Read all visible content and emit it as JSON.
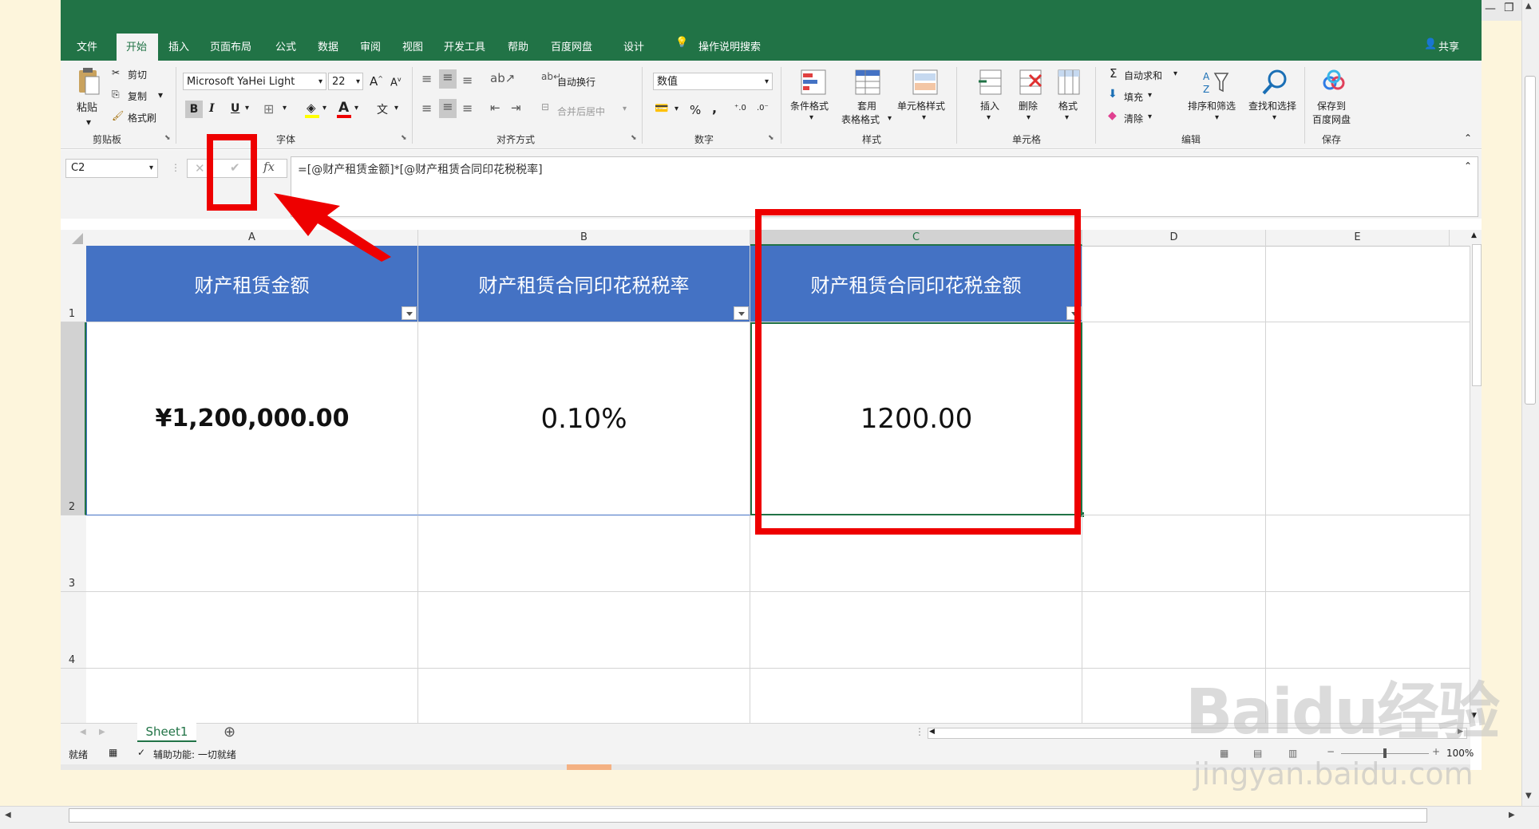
{
  "ribbon_tabs": [
    "文件",
    "开始",
    "插入",
    "页面布局",
    "公式",
    "数据",
    "审阅",
    "视图",
    "开发工具",
    "帮助",
    "百度网盘",
    "设计"
  ],
  "active_tab": "开始",
  "tell_me": "操作说明搜索",
  "share": "共享",
  "clipboard": {
    "paste": "粘贴",
    "cut": "剪切",
    "copy": "复制",
    "format_painter": "格式刷",
    "label": "剪贴板"
  },
  "font": {
    "name": "Microsoft YaHei Light",
    "size": "22",
    "bold": "B",
    "italic": "I",
    "underline": "U",
    "font_color_glyph": "A",
    "wen": "文",
    "label": "字体"
  },
  "alignment": {
    "wrap": "自动换行",
    "merge": "合并后居中",
    "label": "对齐方式"
  },
  "number": {
    "format": "数值",
    "percent": "%",
    "comma": ",",
    "label": "数字"
  },
  "styles": {
    "conditional": "条件格式",
    "table_line1": "套用",
    "table_line2": "表格格式",
    "cell_styles": "单元格样式",
    "label": "样式"
  },
  "cells": {
    "insert": "插入",
    "delete": "删除",
    "format": "格式",
    "label": "单元格"
  },
  "editing": {
    "autosum": "自动求和",
    "fill": "填充",
    "clear": "清除",
    "sort": "排序和筛选",
    "find": "查找和选择",
    "label": "编辑"
  },
  "save": {
    "line1": "保存到",
    "line2": "百度网盘",
    "label": "保存"
  },
  "namebox": "C2",
  "fx": "fx",
  "formula": "=[@财产租赁金额]*[@财产租赁合同印花税税率]",
  "columns": [
    "A",
    "B",
    "C",
    "D",
    "E"
  ],
  "rows": [
    "1",
    "2",
    "3",
    "4"
  ],
  "headers": [
    "财产租赁金额",
    "财产租赁合同印花税税率",
    "财产租赁合同印花税金额"
  ],
  "values": [
    "¥1,200,000.00",
    "0.10%",
    "1200.00"
  ],
  "sheet": "Sheet1",
  "status": {
    "ready": "就绪",
    "accessibility": "辅助功能: 一切就绪",
    "zoom": "100%"
  },
  "watermark": {
    "brand": "Baidu经验",
    "url": "jingyan.baidu.com"
  },
  "colors": {
    "excel_green": "#217346",
    "header_blue": "#4472c4",
    "annotation_red": "#ee0000"
  }
}
